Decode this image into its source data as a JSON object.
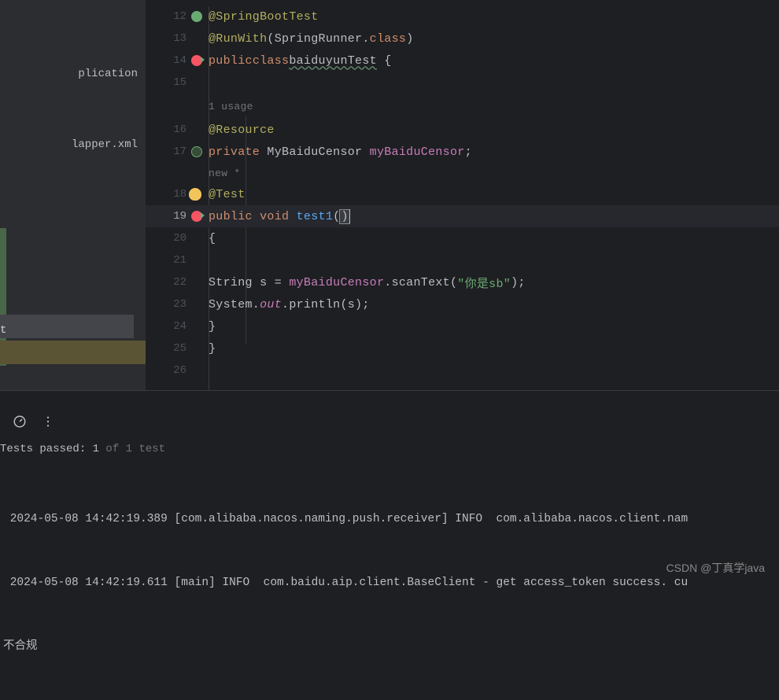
{
  "sidebar": {
    "item_application": "plication",
    "item_mapper": "lapper.xml",
    "item_selected": "t"
  },
  "gutter": {
    "lines": [
      "12",
      "13",
      "14",
      "15",
      "16",
      "17",
      "18",
      "19",
      "20",
      "21",
      "22",
      "23",
      "24",
      "25",
      "26"
    ]
  },
  "code": {
    "l12_ann": "@SpringBootTest",
    "l13_ann": "@RunWith",
    "l13_p1": "(",
    "l13_cls": "SpringRunner",
    "l13_dot": ".",
    "l13_class": "class",
    "l13_p2": ")",
    "l14_kw1": "public",
    "l14_kw2": "class",
    "l14_name": "baiduyunTest",
    "l14_brace": " {",
    "l15_hint": "1 usage",
    "l16_ann": "@Resource",
    "l17_kw": "private",
    "l17_type": " MyBaiduCensor ",
    "l17_field": "myBaiduCensor",
    "l17_semi": ";",
    "l17b_hint": "new *",
    "l18_ann": "@Test",
    "l19_kw1": "public",
    "l19_kw2": " void ",
    "l19_method": "test1",
    "l19_p1": "(",
    "l19_p2": ")",
    "l20_brace": "{",
    "l22_type": "String",
    "l22_var": " s = ",
    "l22_obj": "myBaiduCensor",
    "l22_dot": ".",
    "l22_call": "scanText(",
    "l22_str": "\"你是sb\"",
    "l22_end": ");",
    "l23_sys": "System.",
    "l23_out": "out",
    "l23_call": ".println(s);",
    "l24_brace": "}",
    "l25_brace": "}"
  },
  "test": {
    "status_prefix": "Tests passed: ",
    "status_count": "1",
    "status_suffix": " of 1 test"
  },
  "console": {
    "line1": " 2024-05-08 14:42:19.389 [com.alibaba.nacos.naming.push.receiver] INFO  com.alibaba.nacos.client.nam",
    "line2": " 2024-05-08 14:42:19.611 [main] INFO  com.baidu.aip.client.BaseClient - get access_token success. cu",
    "line3": "不合规"
  },
  "watermark": "CSDN @丁真学java"
}
